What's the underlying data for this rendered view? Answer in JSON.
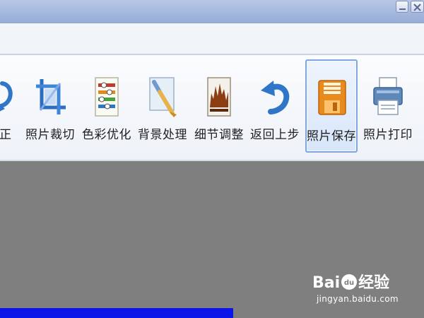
{
  "toolbar": {
    "tools": [
      {
        "label": "矫正",
        "icon": "correct-icon"
      },
      {
        "label": "照片裁切",
        "icon": "crop-icon"
      },
      {
        "label": "色彩优化",
        "icon": "color-optimize-icon"
      },
      {
        "label": "背景处理",
        "icon": "background-brush-icon"
      },
      {
        "label": "细节调整",
        "icon": "detail-adjust-icon"
      },
      {
        "label": "返回上步",
        "icon": "undo-icon"
      },
      {
        "label": "照片保存",
        "icon": "save-icon",
        "active": true
      },
      {
        "label": "照片打印",
        "icon": "print-icon"
      }
    ]
  },
  "watermark": {
    "logo_left": "Bai",
    "logo_right": "经验",
    "logo_paw_letters": "du",
    "url": "jingyan.baidu.com"
  },
  "progress": {
    "fraction": 0.55
  },
  "colors": {
    "workspace": "#7f7f7f",
    "progress": "#0b15e8",
    "toolbar_active_border": "#7fa6de"
  }
}
